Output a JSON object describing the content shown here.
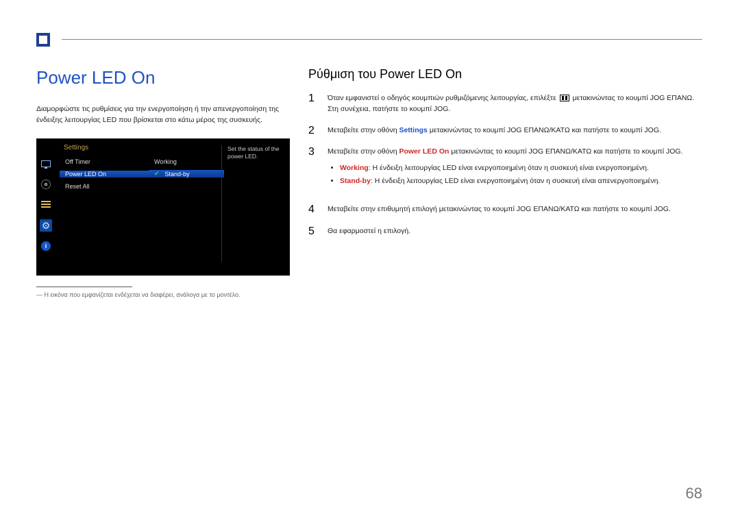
{
  "page_number": "68",
  "left": {
    "heading": "Power LED On",
    "paragraph": "Διαμορφώστε τις ρυθμίσεις για την ενεργοποίηση ή την απενεργοποίηση της ένδειξης λειτουργίας LED που βρίσκεται στο κάτω μέρος της συσκευής.",
    "footnote": "― Η εικόνα που εμφανίζεται ενδέχεται να διαφέρει, ανάλογα με το μοντέλο."
  },
  "osd": {
    "title": "Settings",
    "rows": [
      {
        "label": "Off Timer",
        "value": "Working",
        "selected": false
      },
      {
        "label": "Power LED On",
        "value": "Stand-by",
        "selected": true
      },
      {
        "label": "Reset All",
        "value": "",
        "selected": false
      }
    ],
    "tip": "Set the status of the power LED.",
    "icons": [
      "monitor-icon",
      "target-icon",
      "bars-icon",
      "gear-icon",
      "info-icon"
    ]
  },
  "right": {
    "heading": "Ρύθμιση του Power LED On",
    "steps": {
      "s1_a": "Όταν εμφανιστεί ο οδηγός κουμπιών ρυθμιζόμενης λειτουργίας, επιλέξτε ",
      "s1_b": " μετακινώντας το κουμπί JOG ΕΠΑΝΩ. Στη συνέχεια, πατήστε το κουμπί JOG.",
      "s2_a": "Μεταβείτε στην οθόνη ",
      "s2_kw": "Settings",
      "s2_b": " μετακινώντας το κουμπί JOG ΕΠΑΝΩ/ΚΑΤΩ και πατήστε το κουμπί JOG.",
      "s3_a": "Μεταβείτε στην οθόνη ",
      "s3_kw": "Power LED On",
      "s3_b": " μετακινώντας το κουμπί JOG ΕΠΑΝΩ/ΚΑΤΩ και πατήστε το κουμπί JOG.",
      "b1_kw": "Working",
      "b1_txt": ": Η ένδειξη λειτουργίας LED είναι ενεργοποιημένη όταν η συσκευή είναι ενεργοποιημένη.",
      "b2_kw": "Stand-by",
      "b2_txt": ": Η ένδειξη λειτουργίας LED είναι ενεργοποιημένη όταν η συσκευή είναι απενεργοποιημένη.",
      "s4": "Μεταβείτε στην επιθυμητή επιλογή μετακινώντας το κουμπί JOG ΕΠΑΝΩ/ΚΑΤΩ και πατήστε το κουμπί JOG.",
      "s5": "Θα εφαρμοστεί η επιλογή."
    },
    "nums": {
      "n1": "1",
      "n2": "2",
      "n3": "3",
      "n4": "4",
      "n5": "5"
    }
  }
}
